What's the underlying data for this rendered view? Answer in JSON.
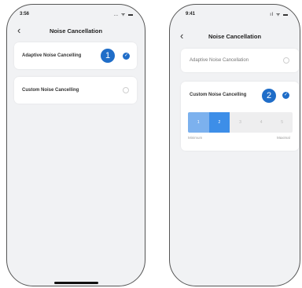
{
  "left_screen": {
    "status_time": "3:56",
    "status_icons": "… ᯤ ▬",
    "title": "Noise Cancellation",
    "options": [
      {
        "label": "Adaptive Noise Cancelling",
        "selected": true
      },
      {
        "label": "Custom Noise Cancelling",
        "selected": false
      }
    ],
    "callout": "1"
  },
  "right_screen": {
    "status_time": "9:41",
    "status_icons": "ıl ᯤ ▬",
    "title": "Noise Cancellation",
    "options": [
      {
        "label": "Adaptive Noise Cancellation",
        "selected": false
      },
      {
        "label": "Custom Noise Cancelling",
        "selected": true
      }
    ],
    "callout": "2",
    "levels": [
      "1",
      "2",
      "3",
      "4",
      "5"
    ],
    "selected_level": 2,
    "min_label": "Minimum",
    "max_label": "Maximal"
  },
  "icons": {
    "back": "‹",
    "check": "✓"
  },
  "colors": {
    "accent": "#1f6dc8",
    "segment_active": "#3d8ee8",
    "background": "#f1f2f4"
  }
}
